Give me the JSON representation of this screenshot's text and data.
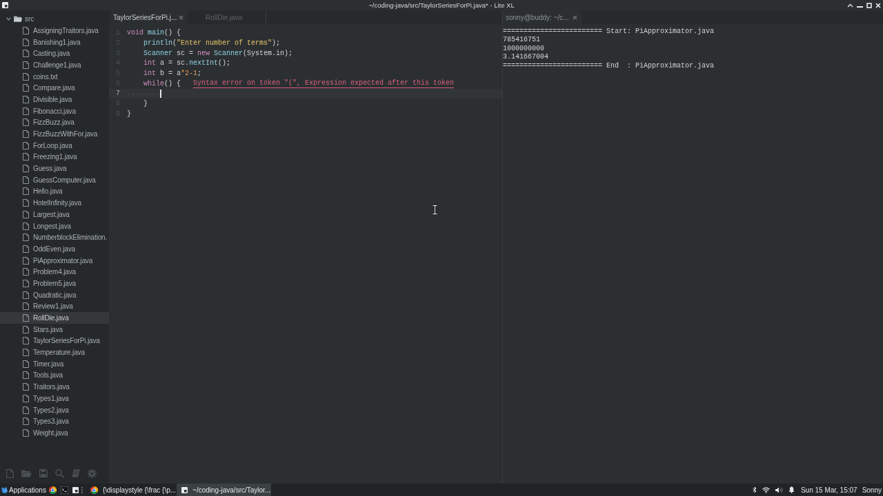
{
  "window": {
    "title": "~/coding-java/src/TaylorSeriesForPi.java* - Lite XL"
  },
  "sidebar": {
    "tree": {
      "label": "src",
      "expanded": true,
      "children": [
        {
          "label": "AssigningTraitors.java",
          "selected": false
        },
        {
          "label": "Banishing1.java",
          "selected": false
        },
        {
          "label": "Casting.java",
          "selected": false
        },
        {
          "label": "Challenge1.java",
          "selected": false
        },
        {
          "label": "coins.txt",
          "selected": false
        },
        {
          "label": "Compare.java",
          "selected": false
        },
        {
          "label": "Divisible.java",
          "selected": false
        },
        {
          "label": "Fibonacci.java",
          "selected": false
        },
        {
          "label": "FizzBuzz.java",
          "selected": false
        },
        {
          "label": "FizzBuzzWithFor.java",
          "selected": false
        },
        {
          "label": "ForLoop.java",
          "selected": false
        },
        {
          "label": "Freezing1.java",
          "selected": false
        },
        {
          "label": "Guess.java",
          "selected": false
        },
        {
          "label": "GuessComputer.java",
          "selected": false
        },
        {
          "label": "Hello.java",
          "selected": false
        },
        {
          "label": "HotelInfinity.java",
          "selected": false
        },
        {
          "label": "Largest.java",
          "selected": false
        },
        {
          "label": "Longest.java",
          "selected": false
        },
        {
          "label": "NumberblockElimination.",
          "selected": false
        },
        {
          "label": "OddEven.java",
          "selected": false
        },
        {
          "label": "PiApproximator.java",
          "selected": false
        },
        {
          "label": "Problem4.java",
          "selected": false
        },
        {
          "label": "Problem5.java",
          "selected": false
        },
        {
          "label": "Quadratic.java",
          "selected": false
        },
        {
          "label": "Review1.java",
          "selected": false
        },
        {
          "label": "RollDie.java",
          "selected": true
        },
        {
          "label": "Stars.java",
          "selected": false
        },
        {
          "label": "TaylorSeriesForPi.java",
          "selected": false
        },
        {
          "label": "Temperature.java",
          "selected": false
        },
        {
          "label": "Timer.java",
          "selected": false
        },
        {
          "label": "Tools.java",
          "selected": false
        },
        {
          "label": "Traitors.java",
          "selected": false
        },
        {
          "label": "Types1.java",
          "selected": false
        },
        {
          "label": "Types2.java",
          "selected": false
        },
        {
          "label": "Types3.java",
          "selected": false
        },
        {
          "label": "Weight.java",
          "selected": false
        }
      ]
    }
  },
  "editor": {
    "tabs": [
      {
        "label": "TaylorSeriesForPi.j...",
        "selected": true
      },
      {
        "label": "RollDie.java",
        "selected": false
      }
    ],
    "lines": [
      {
        "number": "1",
        "current": false,
        "tokens": [
          {
            "kind": "keyword",
            "text": "void "
          },
          {
            "kind": "function",
            "text": "main"
          },
          {
            "kind": "plain",
            "text": "() {"
          }
        ],
        "children": [
          {
            "number": "2",
            "current": false,
            "tokens": [
              {
                "kind": "function",
                "text": "println"
              },
              {
                "kind": "plain",
                "text": "("
              },
              {
                "kind": "string",
                "text": "\"Enter number of terms\""
              },
              {
                "kind": "plain",
                "text": ");"
              }
            ]
          },
          {
            "number": "3",
            "current": false,
            "tokens": [
              {
                "kind": "type",
                "text": "Scanner"
              },
              {
                "kind": "plain",
                "text": " sc = "
              },
              {
                "kind": "keyword",
                "text": "new "
              },
              {
                "kind": "type",
                "text": "Scanner"
              },
              {
                "kind": "plain",
                "text": "(System.in);"
              }
            ]
          },
          {
            "number": "4",
            "current": false,
            "tokens": [
              {
                "kind": "keyword",
                "text": "int"
              },
              {
                "kind": "plain",
                "text": " a = sc."
              },
              {
                "kind": "function",
                "text": "nextInt"
              },
              {
                "kind": "plain",
                "text": "();"
              }
            ]
          },
          {
            "number": "5",
            "current": false,
            "tokens": [
              {
                "kind": "keyword",
                "text": "int"
              },
              {
                "kind": "plain",
                "text": " b = a"
              },
              {
                "kind": "operator",
                "text": "*"
              },
              {
                "kind": "number",
                "text": "2"
              },
              {
                "kind": "operator",
                "text": "-"
              },
              {
                "kind": "number",
                "text": "1"
              },
              {
                "kind": "plain",
                "text": ";"
              }
            ]
          },
          {
            "number": "6",
            "current": false,
            "tokens": [
              {
                "kind": "keyword",
                "text": "while"
              },
              {
                "kind": "plain",
                "text": "() {"
              }
            ],
            "error": "Syntax error on token \"(\", Expression expected after this token",
            "children": [
              {
                "number": "7",
                "current": true
              }
            ]
          },
          {
            "number": "8",
            "current": false,
            "tokens": [
              {
                "kind": "plain",
                "text": "}"
              }
            ]
          }
        ]
      },
      {
        "number": "9",
        "current": false,
        "tokens": [
          {
            "kind": "plain",
            "text": "}"
          }
        ]
      }
    ]
  },
  "terminal": {
    "tabs": [
      {
        "label": "sonny@buddy: ~/c...",
        "selected": true
      }
    ],
    "lines": [
      "======================== Start: PiApproximator.java",
      "785416751",
      "1000000000",
      "3.141667004",
      "======================== End  : PiApproximator.java"
    ]
  },
  "taskbar": {
    "menu_label": "Applications",
    "launchers": [
      {
        "kind": "browser"
      },
      {
        "kind": "terminal"
      },
      {
        "kind": "editor"
      }
    ],
    "tasks": [
      {
        "kind": "browser",
        "label": "{\\displaystyle {\\frac {\\p...",
        "selected": false
      },
      {
        "kind": "editor",
        "label": "~/coding-java/src/Taylor...",
        "selected": true
      }
    ],
    "clock": "Sun 15 Mar, 15:07",
    "user": "Sonny"
  }
}
